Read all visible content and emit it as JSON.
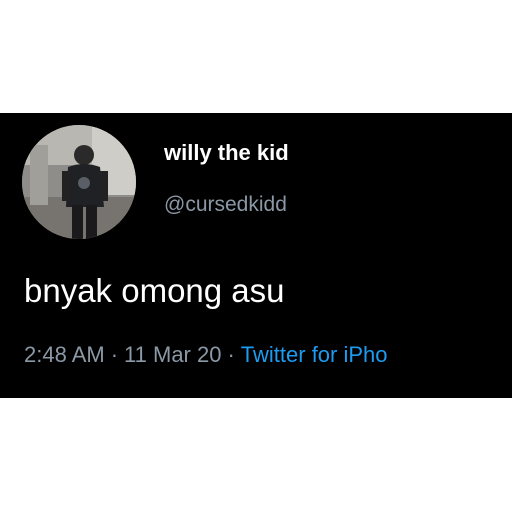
{
  "tweet": {
    "display_name": "willy the kid",
    "handle": "@cursedkidd",
    "text": "bnyak omong asu",
    "time": "2:48 AM",
    "separator": "·",
    "date": "11 Mar 20",
    "source": "Twitter for iPho",
    "avatar_icon": "profile-photo-person-back-view"
  },
  "colors": {
    "card_background": "#000000",
    "name_color": "#ffffff",
    "muted_text": "#8b98a5",
    "link_color": "#1d9bf0",
    "page_background": "#ffffff"
  }
}
